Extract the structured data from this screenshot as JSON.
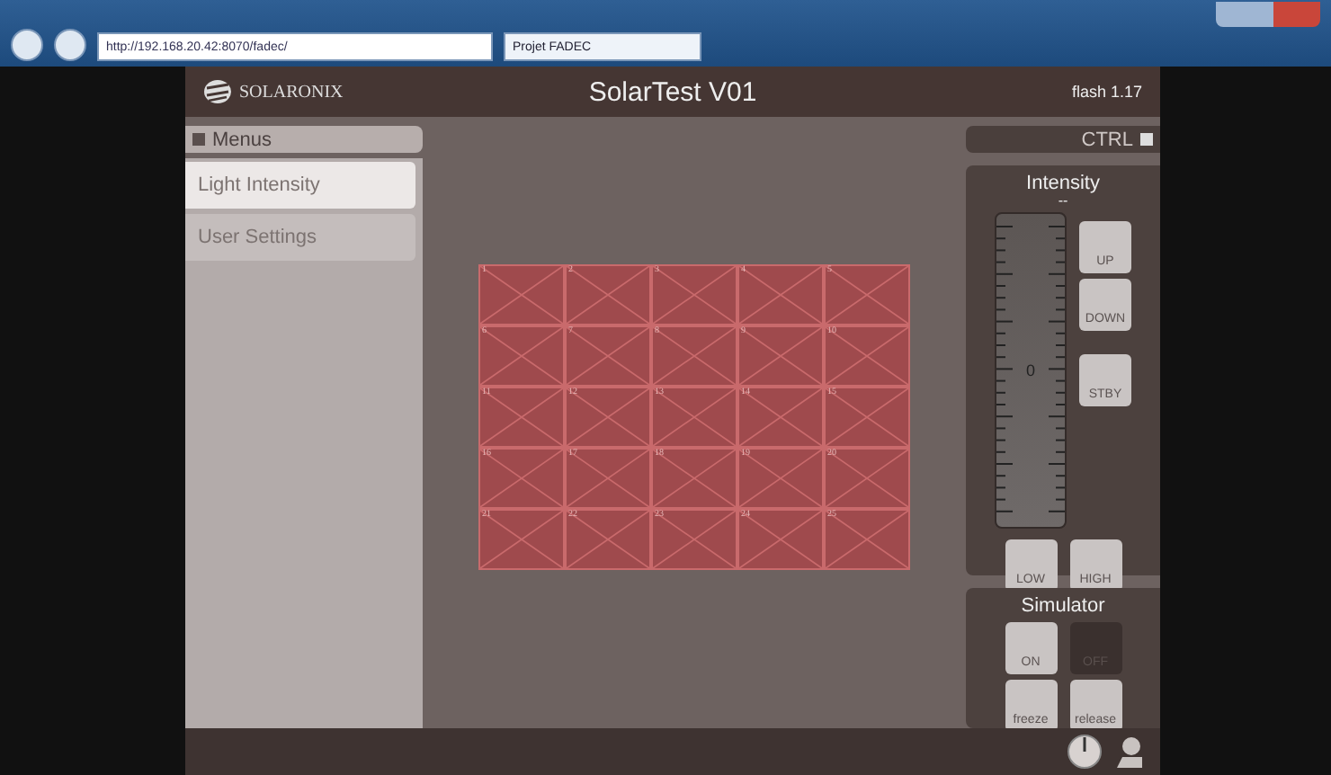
{
  "browser": {
    "address": "http://192.168.20.42:8070/fadec/",
    "tab": "Projet FADEC"
  },
  "header": {
    "logo": "SOLARONIX",
    "title": "SolarTest V01",
    "version": "flash 1.17"
  },
  "menus": {
    "title": "Menus",
    "items": [
      {
        "label": "Light Intensity",
        "selected": true
      },
      {
        "label": "User Settings",
        "selected": false
      }
    ]
  },
  "grid": {
    "cells": [
      "1",
      "2",
      "3",
      "4",
      "5",
      "6",
      "7",
      "8",
      "9",
      "10",
      "11",
      "12",
      "13",
      "14",
      "15",
      "16",
      "17",
      "18",
      "19",
      "20",
      "21",
      "22",
      "23",
      "24",
      "25"
    ]
  },
  "ctrl": {
    "label": "CTRL"
  },
  "intensity": {
    "title": "Intensity",
    "reading": "--",
    "scale_label": "0",
    "side_buttons": [
      "UP",
      "DOWN",
      "STBY"
    ],
    "bottom_buttons": [
      "LOW",
      "HIGH"
    ]
  },
  "simulator": {
    "title": "Simulator",
    "buttons": [
      {
        "label": "ON",
        "selected": false
      },
      {
        "label": "OFF",
        "selected": true
      },
      {
        "label": "freeze",
        "selected": false
      },
      {
        "label": "release",
        "selected": false
      }
    ]
  }
}
